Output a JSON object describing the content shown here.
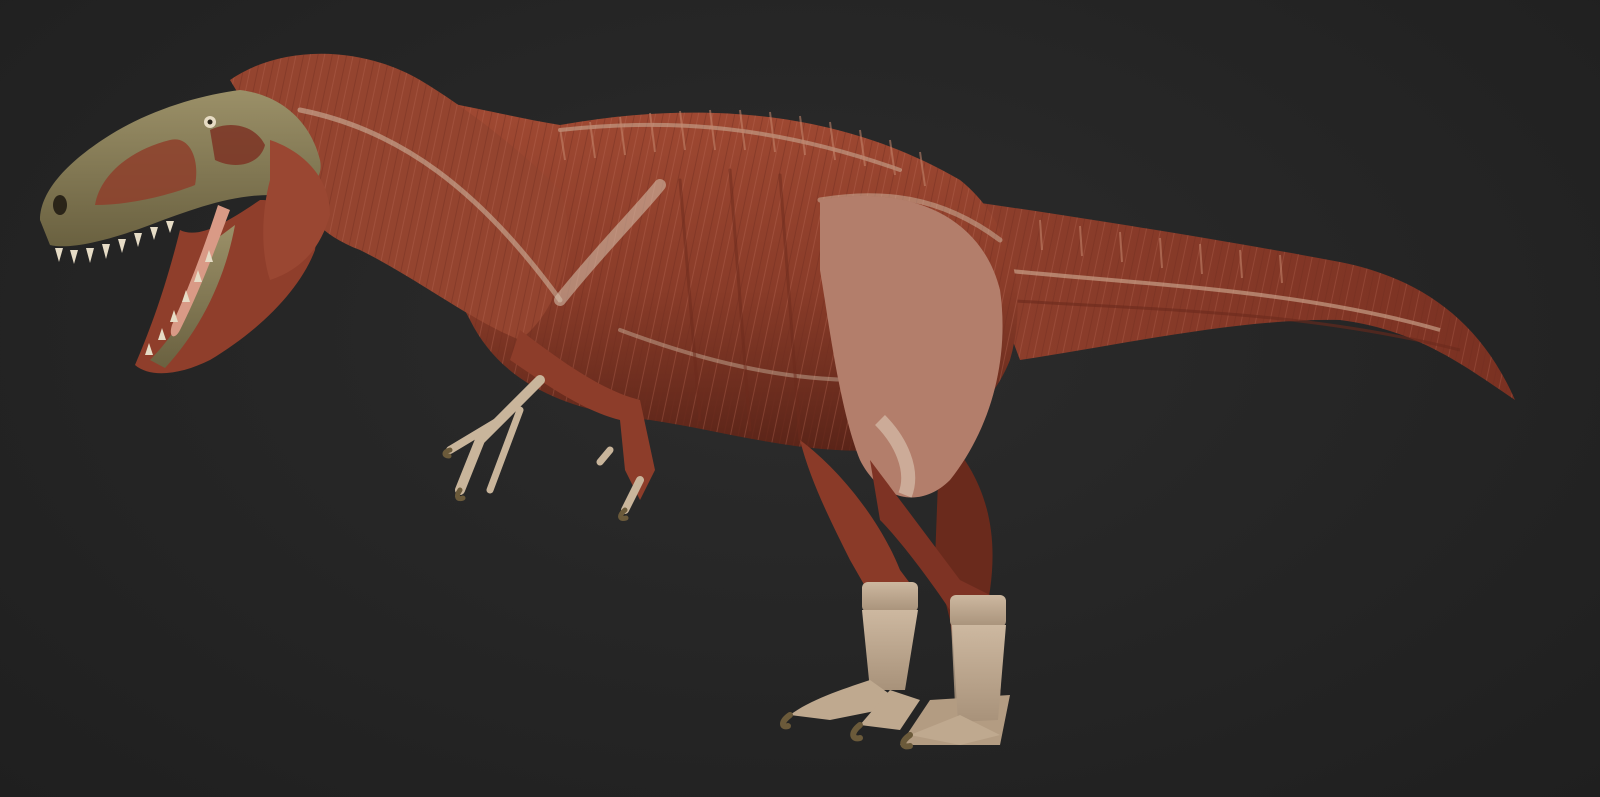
{
  "scene": {
    "subject": "dinosaur-muscle-anatomy-render",
    "background_color": "#242424",
    "palette": {
      "muscle": "#8e3f2c",
      "muscle_dark": "#5e2619",
      "muscle_light": "#b4604a",
      "tendon": "#d8c7b2",
      "skull": "#8f8560",
      "skull_dark": "#4d4630",
      "tongue": "#d99a86",
      "claw": "#6b5a3a"
    }
  }
}
